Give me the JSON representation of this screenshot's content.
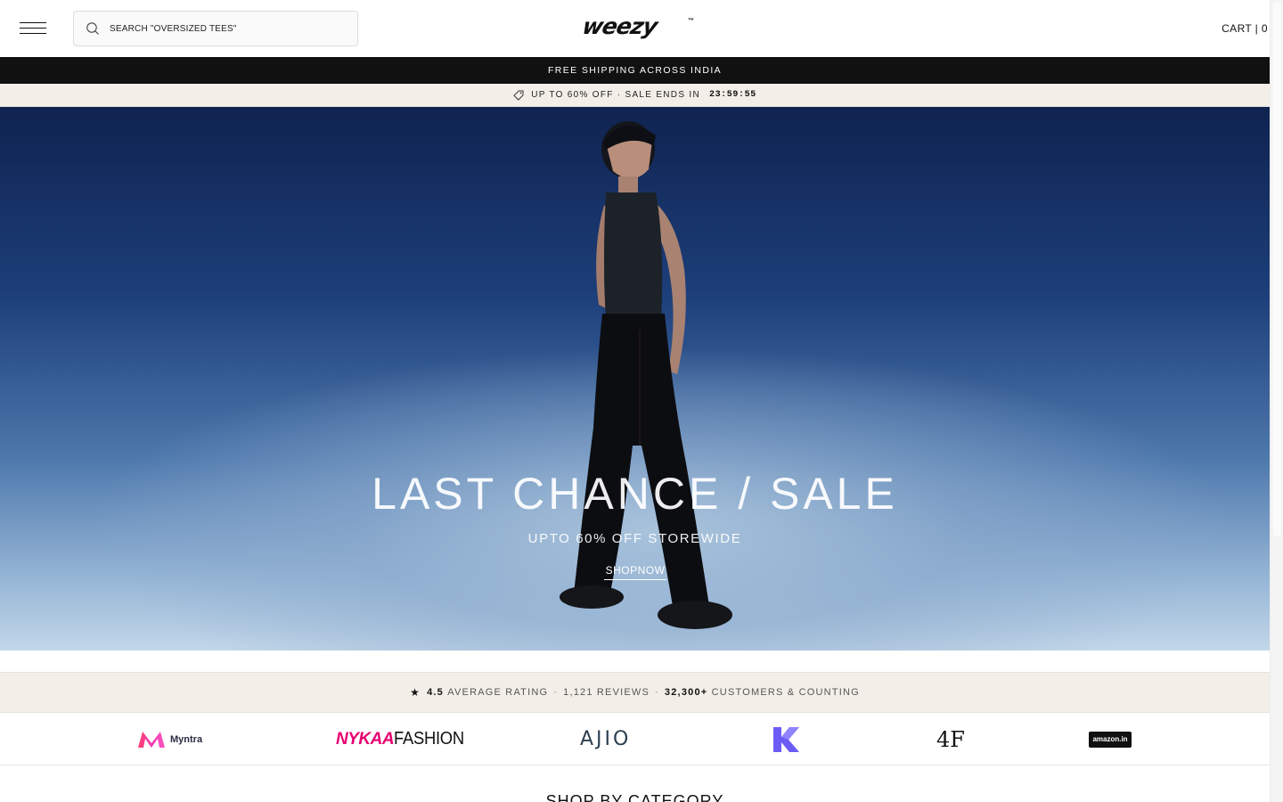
{
  "header": {
    "search_placeholder": "SEARCH \"OVERSIZED TEES\"",
    "logo_text": "weezy",
    "logo_mark": "™",
    "cart_label": "CART | 0"
  },
  "announcement": {
    "shipping": "FREE SHIPPING ACROSS INDIA",
    "sale_text": "UP TO 60% OFF · SALE ENDS IN",
    "countdown": "23:59:55"
  },
  "hero": {
    "title": "LAST CHANCE / SALE",
    "subtitle": "UPTO 60% OFF STOREWIDE",
    "cta": "SHOPNOW"
  },
  "rating": {
    "score": "4.5",
    "score_label": "AVERAGE RATING",
    "reviews": "1,121 REVIEWS",
    "customers": "32,300+",
    "customers_label": "CUSTOMERS & COUNTING"
  },
  "marketplaces": {
    "myntra": "Myntra",
    "nykaa_a": "NYKAA",
    "nykaa_b": "FASHION",
    "ajio": "AJIO",
    "fourf": "4F",
    "amazon": "amazon.in"
  },
  "category": {
    "heading": "SHOP BY CATEGORY"
  },
  "colors": {
    "announcement_bg": "#111111",
    "cream": "#f3efe8",
    "myntra_pink": "#ff3f6c",
    "nykaa_pink": "#e80071",
    "k_purple": "#6b5cf5"
  }
}
